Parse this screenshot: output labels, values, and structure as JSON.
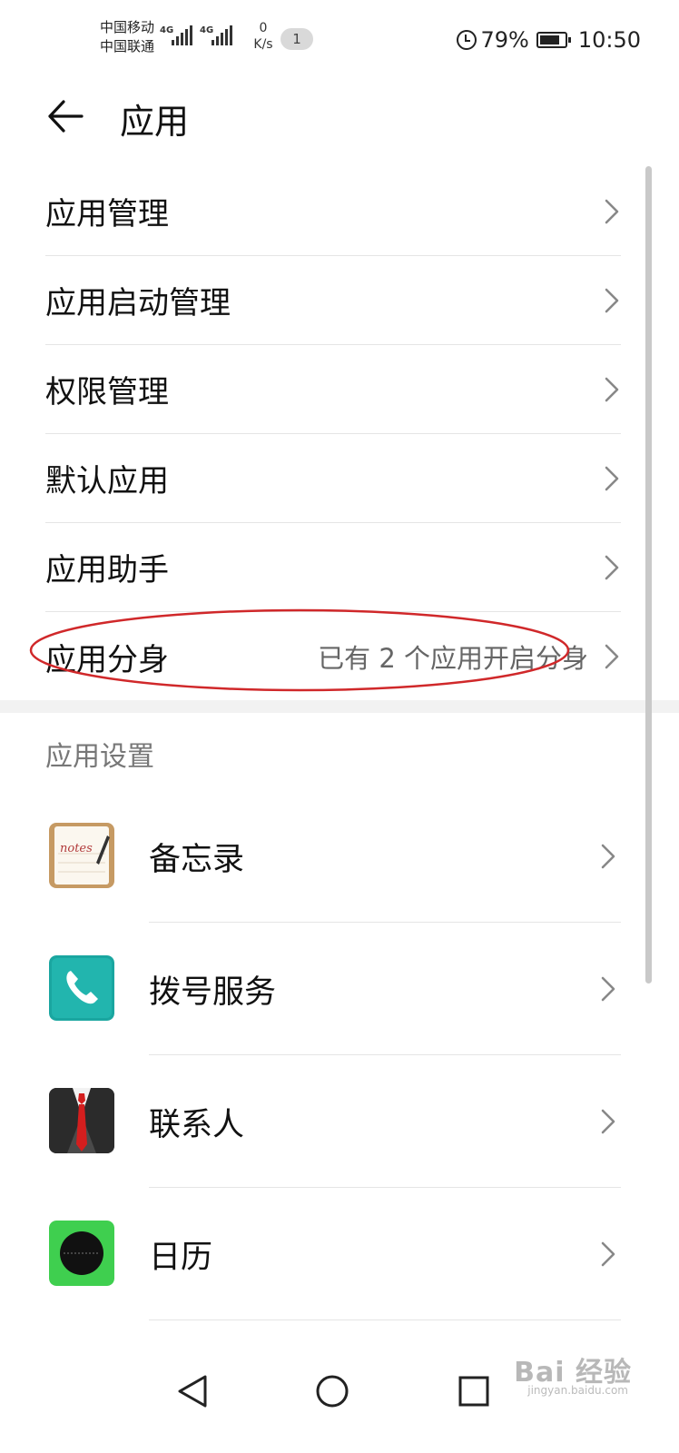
{
  "status_bar": {
    "carrier_1": "中国移动",
    "carrier_2": "中国联通",
    "network_1": "4G",
    "network_2": "4G",
    "speed_value": "0",
    "speed_unit": "K/s",
    "notification_count": "1",
    "battery_percent": "79%",
    "battery_level": 0.79,
    "time": "10:50"
  },
  "header": {
    "title": "应用"
  },
  "menu": [
    {
      "label": "应用管理",
      "value": ""
    },
    {
      "label": "应用启动管理",
      "value": ""
    },
    {
      "label": "权限管理",
      "value": ""
    },
    {
      "label": "默认应用",
      "value": ""
    },
    {
      "label": "应用助手",
      "value": ""
    },
    {
      "label": "应用分身",
      "value": "已有 2 个应用开启分身"
    }
  ],
  "app_settings": {
    "title": "应用设置",
    "apps": [
      {
        "label": "备忘录",
        "icon": "notes-icon",
        "icon_text": "notes"
      },
      {
        "label": "拨号服务",
        "icon": "phone-icon"
      },
      {
        "label": "联系人",
        "icon": "contacts-icon"
      },
      {
        "label": "日历",
        "icon": "calendar-icon"
      }
    ]
  },
  "watermark": {
    "text": "Bai 经验",
    "sub": "jingyan.baidu.com"
  },
  "colors": {
    "annotation": "#d0282a",
    "phone_teal": "#1aa6a0",
    "calendar_green": "#3fcf4f"
  }
}
